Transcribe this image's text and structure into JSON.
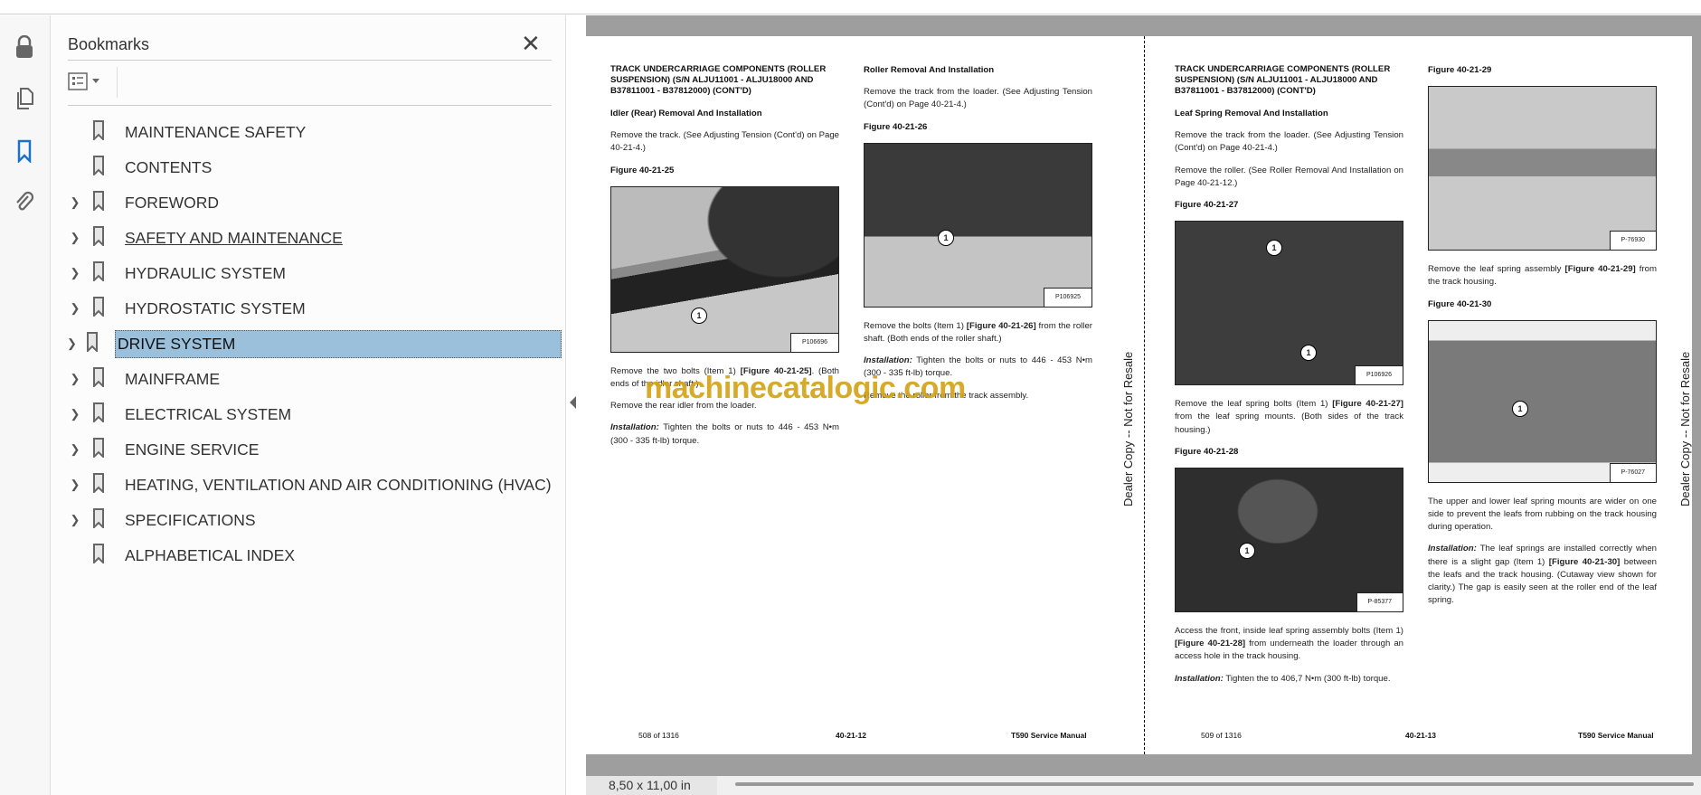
{
  "sidebar": {
    "title": "Bookmarks",
    "items": [
      {
        "label": "MAINTENANCE SAFETY",
        "expandable": false
      },
      {
        "label": "CONTENTS",
        "expandable": false
      },
      {
        "label": "FOREWORD",
        "expandable": true
      },
      {
        "label": "SAFETY AND MAINTENANCE",
        "expandable": true
      },
      {
        "label": "HYDRAULIC SYSTEM",
        "expandable": true
      },
      {
        "label": "HYDROSTATIC SYSTEM",
        "expandable": true
      },
      {
        "label": "DRIVE SYSTEM",
        "expandable": true,
        "selected": true
      },
      {
        "label": "MAINFRAME",
        "expandable": true
      },
      {
        "label": "ELECTRICAL SYSTEM",
        "expandable": true
      },
      {
        "label": "ENGINE SERVICE",
        "expandable": true
      },
      {
        "label": "HEATING, VENTILATION AND AIR CONDITIONING (HVAC)",
        "expandable": true
      },
      {
        "label": "SPECIFICATIONS",
        "expandable": true
      },
      {
        "label": "ALPHABETICAL INDEX",
        "expandable": false
      }
    ]
  },
  "page1": {
    "heading": "TRACK UNDERCARRIAGE COMPONENTS (ROLLER SUSPENSION) (S/N ALJU11001 - ALJU18000 AND B37811001 - B37812000) (CONT'D)",
    "sub1": "Idler (Rear) Removal And Installation",
    "p1": "Remove the track. (See Adjusting Tension (Cont'd) on Page 40-21-4.)",
    "fig25": "Figure 40-21-25",
    "fig25_code": "P106696",
    "callout": "1",
    "p2a": "Remove the two bolts (Item 1) ",
    "p2b": "[Figure 40-21-25]",
    "p2c": ". (Both ends of the idler shaft.)",
    "p3": "Remove the rear idler from the loader.",
    "inst_label": "Installation:",
    "inst": " Tighten the bolts or nuts to 446 - 453 N•m (300 - 335 ft-lb) torque.",
    "sub2": "Roller Removal And Installation",
    "p4": "Remove the track from the loader. (See Adjusting Tension (Cont'd) on Page 40-21-4.)",
    "fig26": "Figure 40-21-26",
    "fig26_code": "P106925",
    "p5a": "Remove the bolts (Item 1) ",
    "p5b": "[Figure 40-21-26]",
    "p5c": " from the roller shaft. (Both ends of the roller shaft.)",
    "inst2": " Tighten the bolts or nuts to 446 - 453 N•m (300 - 335 ft-lb) torque.",
    "p6": "Remove the roller from the track assembly.",
    "footer_page": "508 of 1316",
    "footer_code": "40-21-12",
    "footer_title": "T590 Service Manual"
  },
  "page2": {
    "heading": "TRACK UNDERCARRIAGE COMPONENTS (ROLLER SUSPENSION) (S/N ALJU11001 - ALJU18000 AND B37811001 - B37812000) (CONT'D)",
    "sub1": "Leaf Spring Removal And Installation",
    "p1": "Remove the track from the loader. (See Adjusting Tension (Cont'd) on Page 40-21-4.)",
    "p2": "Remove the roller. (See Roller Removal And Installation on Page 40-21-12.)",
    "fig27": "Figure 40-21-27",
    "fig27_code": "P106926",
    "p3a": "Remove the leaf spring bolts (Item 1) ",
    "p3b": "[Figure 40-21-27]",
    "p3c": " from the leaf spring mounts. (Both sides of the track housing.)",
    "fig28": "Figure 40-21-28",
    "fig28_code": "P-85377",
    "p4a": "Access the front, inside leaf spring assembly bolts (Item 1) ",
    "p4b": "[Figure 40-21-28]",
    "p4c": " from underneath the loader through an access hole in the track housing.",
    "inst_label": "Installation:",
    "inst": " Tighten the to 406,7 N•m (300 ft-lb) torque.",
    "fig29": "Figure 40-21-29",
    "fig29_code": "P-76930",
    "p5a": "Remove the leaf spring assembly ",
    "p5b": "[Figure 40-21-29]",
    "p5c": " from the track housing.",
    "fig30": "Figure 40-21-30",
    "fig30_code": "P-76027",
    "p6": "The upper and lower leaf spring mounts are wider on one side to prevent the leafs from rubbing on the track housing during operation.",
    "inst2a": " The leaf springs are installed correctly when there is a slight gap (Item 1) ",
    "inst2b": "[Figure 40-21-30]",
    "inst2c": " between the leafs and the track housing. (Cutaway view shown for clarity.) The gap is easily seen at the roller end of the leaf spring.",
    "footer_page": "509 of 1316",
    "footer_code": "40-21-13",
    "footer_title": "T590 Service Manual"
  },
  "watermark": "Dealer Copy -- Not for Resale",
  "site_watermark": "machinecatalogic.com",
  "status": {
    "page_size": "8,50 x 11,00 in"
  }
}
